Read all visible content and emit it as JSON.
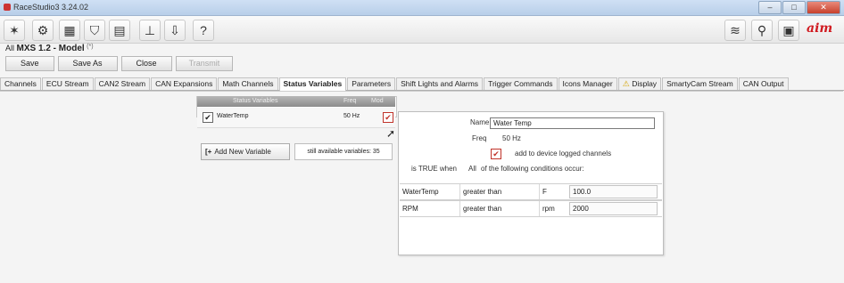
{
  "window": {
    "title": "RaceStudio3 3.24.02",
    "controls": [
      "–",
      "□",
      "✕"
    ]
  },
  "toolbar": {
    "icons": [
      {
        "name": "tools-icon",
        "glyph": "✶"
      },
      {
        "name": "config-icon",
        "glyph": "⚙"
      },
      {
        "name": "dashboard-icon",
        "glyph": "▦"
      },
      {
        "name": "track-icon",
        "glyph": "⛉"
      },
      {
        "name": "clapper-icon",
        "glyph": "▤"
      },
      {
        "name": "device-settings-icon",
        "glyph": "⊥"
      },
      {
        "name": "download-icon",
        "glyph": "⇩"
      },
      {
        "name": "help-icon",
        "glyph": "?"
      },
      {
        "name": "wifi-icon",
        "glyph": "≋"
      },
      {
        "name": "connection-icon",
        "glyph": "⚲"
      },
      {
        "name": "ecu-icon",
        "glyph": "▣"
      }
    ],
    "logo": "aim"
  },
  "breadcrumb": {
    "prefix": "All",
    "model": "MXS 1.2 - Model",
    "pin": "(*)"
  },
  "actions": {
    "save": "Save",
    "save_as": "Save As",
    "close": "Close",
    "transmit": "Transmit"
  },
  "tabs": [
    "Channels",
    "ECU Stream",
    "CAN2 Stream",
    "CAN Expansions",
    "Math Channels",
    "Status Variables",
    "Parameters",
    "Shift Lights and Alarms",
    "Trigger Commands",
    "Icons Manager",
    "Display",
    "SmartyCam Stream",
    "CAN Output"
  ],
  "active_tab": "Status Variables",
  "status_variables": {
    "header": {
      "name": "Status Variables",
      "freq": "Freq",
      "mode": "Mod"
    },
    "rows": [
      {
        "name": "WaterTemp",
        "freq": "50 Hz",
        "checked": true
      }
    ],
    "add_button": "Add New Variable",
    "available_text": "still available variables: 35"
  },
  "detail": {
    "name_label": "Name",
    "name_value": "Water Temp",
    "freq_label": "Freq",
    "freq_value": "50 Hz",
    "logged_label": "add to device logged channels",
    "logged_checked": true,
    "condition_prefix": "is TRUE when",
    "condition_mode": "All",
    "condition_suffix": "of the following conditions occur:",
    "conditions": [
      {
        "channel": "WaterTemp",
        "op": "greater than",
        "unit": "F",
        "value": "100.0"
      },
      {
        "channel": "RPM",
        "op": "greater than",
        "unit": "rpm",
        "value": "2000"
      }
    ]
  }
}
